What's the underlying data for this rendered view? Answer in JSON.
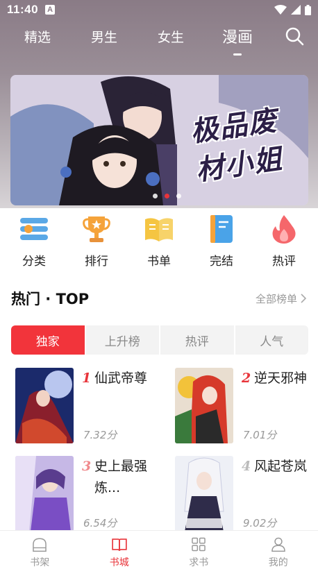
{
  "status_bar": {
    "time": "11:40",
    "notif_letter": "A"
  },
  "top_nav": {
    "tabs": [
      {
        "label": "精选",
        "active": false
      },
      {
        "label": "男生",
        "active": false
      },
      {
        "label": "女生",
        "active": false
      },
      {
        "label": "漫画",
        "active": true
      }
    ]
  },
  "banner": {
    "title": "极品废材小姐",
    "dots": 3,
    "active_dot": 2
  },
  "quick_entries": [
    {
      "label": "分类",
      "icon": "category-icon"
    },
    {
      "label": "排行",
      "icon": "trophy-icon"
    },
    {
      "label": "书单",
      "icon": "book-list-icon"
    },
    {
      "label": "完结",
      "icon": "finished-book-icon"
    },
    {
      "label": "热评",
      "icon": "flame-icon"
    }
  ],
  "section": {
    "title": "热门 · TOP",
    "more": "全部榜单"
  },
  "segments": [
    {
      "label": "独家",
      "active": true
    },
    {
      "label": "上升榜",
      "active": false
    },
    {
      "label": "热评",
      "active": false
    },
    {
      "label": "人气",
      "active": false
    }
  ],
  "rankings": [
    {
      "rank": "1",
      "name": "仙武帝尊",
      "score": "7.32分"
    },
    {
      "rank": "2",
      "name": "逆天邪神",
      "score": "7.01分"
    },
    {
      "rank": "3",
      "name": "史上最强炼...",
      "score": "6.54分"
    },
    {
      "rank": "4",
      "name": "风起苍岚",
      "score": "9.02分"
    }
  ],
  "bottom_nav": [
    {
      "label": "书架",
      "icon": "bookshelf-icon",
      "active": false
    },
    {
      "label": "书城",
      "icon": "bookstore-icon",
      "active": true
    },
    {
      "label": "求书",
      "icon": "request-book-icon",
      "active": false
    },
    {
      "label": "我的",
      "icon": "profile-icon",
      "active": false
    }
  ],
  "colors": {
    "accent": "#e8343a",
    "muted": "#999999"
  }
}
